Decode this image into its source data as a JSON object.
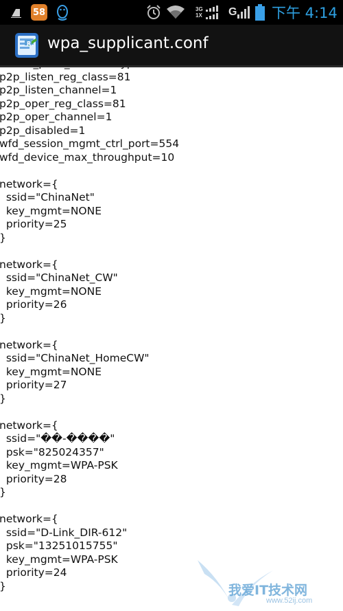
{
  "status_bar": {
    "notification_count": "58",
    "net_top": "3G",
    "net_bottom": "1X",
    "network_type": "G",
    "clock": "下午 4:14",
    "icons": [
      "sd-card-icon",
      "notification-58-badge",
      "qq-penguin-icon",
      "alarm-clock-icon",
      "wifi-icon",
      "signal-icon",
      "battery-icon"
    ]
  },
  "app": {
    "title": "wpa_supplicant.conf",
    "icon": "file-editor-app-icon"
  },
  "file": {
    "lines": [
      "virtual_push_button keypad",
      "p2p_listen_reg_class=81",
      "p2p_listen_channel=1",
      "p2p_oper_reg_class=81",
      "p2p_oper_channel=1",
      "p2p_disabled=1",
      "wfd_session_mgmt_ctrl_port=554",
      "wfd_device_max_throughput=10",
      "",
      "network={",
      "  ssid=\"ChinaNet\"",
      "  key_mgmt=NONE",
      "  priority=25",
      "}",
      "",
      "network={",
      "  ssid=\"ChinaNet_CW\"",
      "  key_mgmt=NONE",
      "  priority=26",
      "}",
      "",
      "network={",
      "  ssid=\"ChinaNet_HomeCW\"",
      "  key_mgmt=NONE",
      "  priority=27",
      "}",
      "",
      "network={",
      "  ssid=\"��-����\"",
      "  psk=\"825024357\"",
      "  key_mgmt=WPA-PSK",
      "  priority=28",
      "}",
      "",
      "network={",
      "  ssid=\"D-Link_DIR-612\"",
      "  psk=\"13251015755\"",
      "  key_mgmt=WPA-PSK",
      "  priority=24",
      "}"
    ]
  },
  "watermark": {
    "text": "我爱IT技术网",
    "url": "www.52ij.com"
  }
}
